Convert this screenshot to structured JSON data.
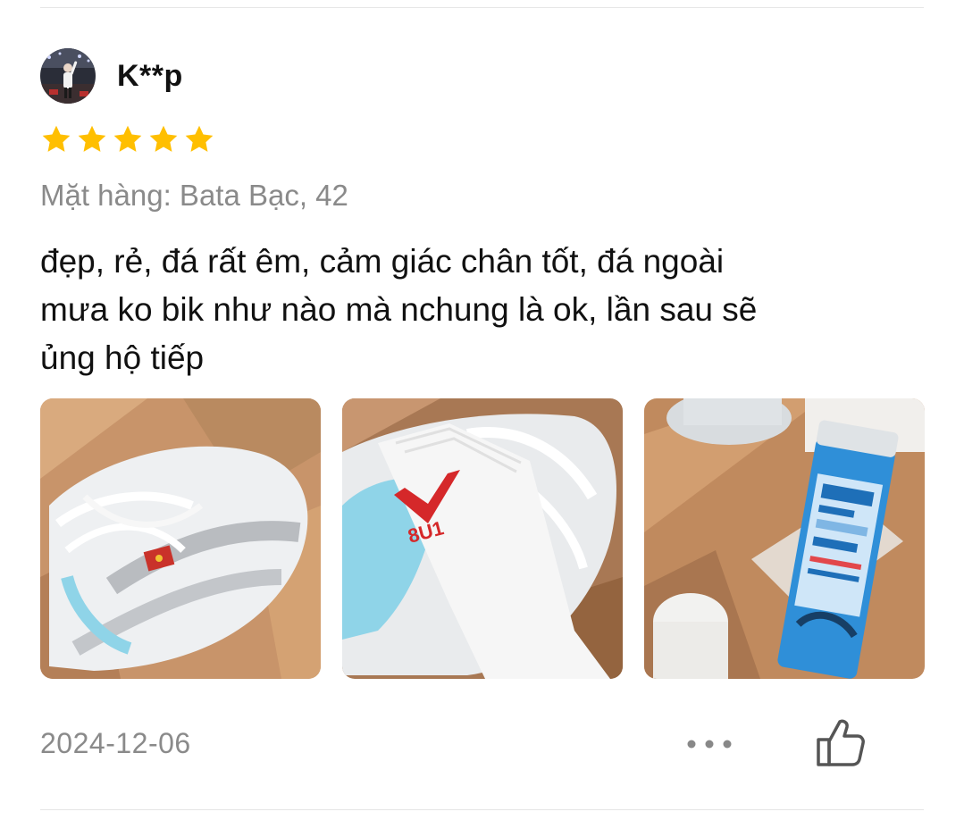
{
  "review": {
    "reviewer_name": "K**p",
    "rating": 5,
    "rating_max": 5,
    "variant": "Mặt hàng: Bata Bạc, 42",
    "text_lines": [
      "đẹp, rẻ, đá rất êm, cảm giác chân tốt, đá ngoài",
      "mưa ko bik như nào mà nchung là ok, lần sau sẽ",
      "ủng hộ tiếp"
    ],
    "date": "2024-12-06",
    "photos": [
      {
        "icon": "shoe-photo"
      },
      {
        "icon": "sock-photo"
      },
      {
        "icon": "spray-can-photo"
      }
    ]
  },
  "colors": {
    "star": "#FFBF00",
    "muted_text": "#8a8a8a",
    "divider": "#e6e6e6"
  },
  "icons": {
    "more": "more-dots-icon",
    "like": "thumbs-up-icon",
    "star": "star-icon"
  }
}
